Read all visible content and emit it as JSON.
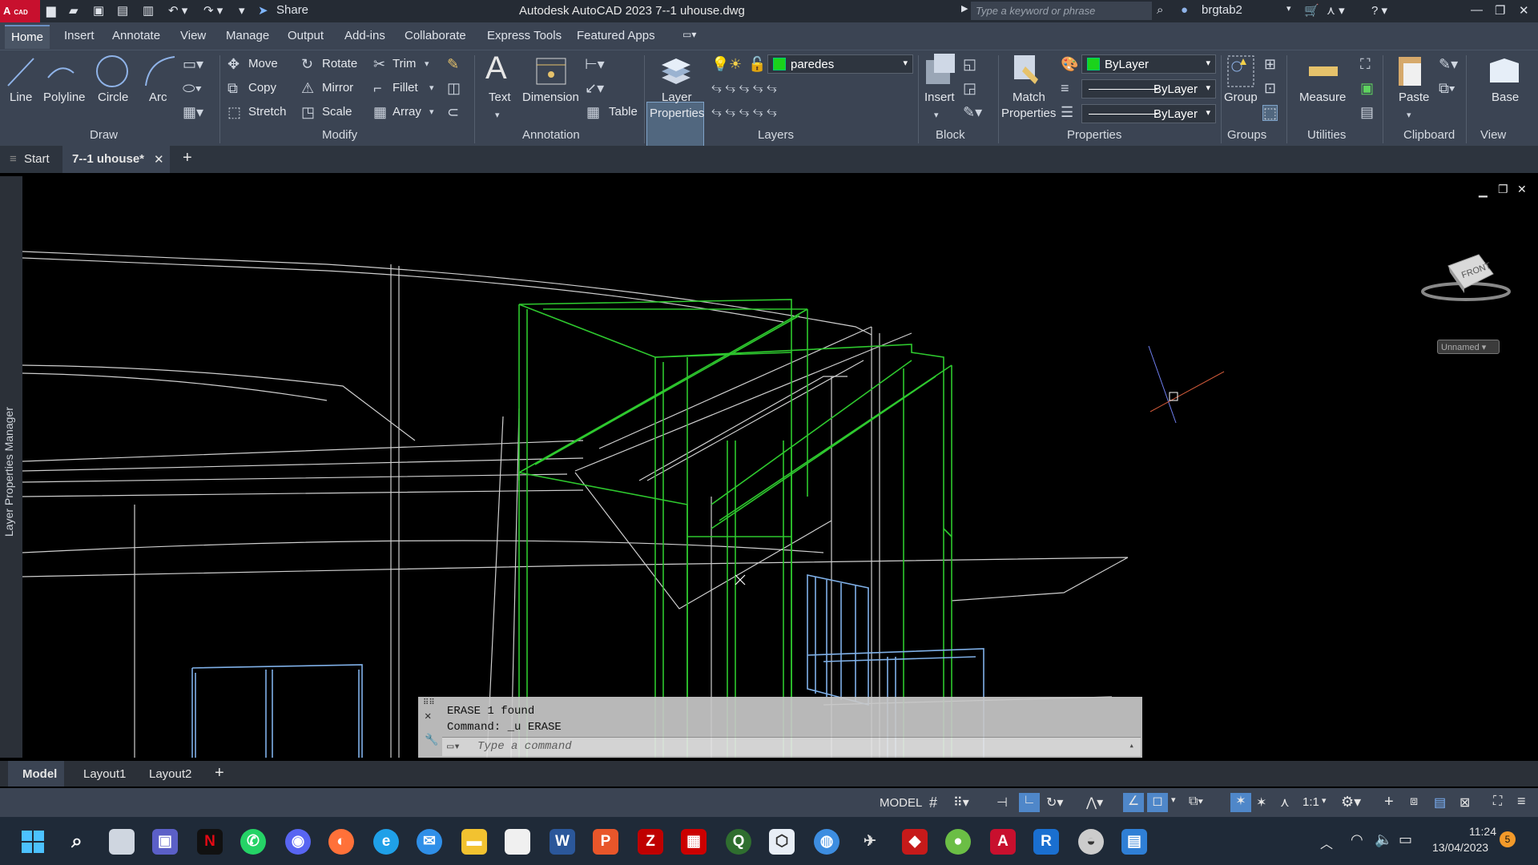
{
  "titlebar": {
    "logo": "A",
    "logo_sub": "CAD",
    "share": "Share",
    "title": "Autodesk AutoCAD 2023    7--1 uhouse.dwg",
    "search_placeholder": "Type a keyword or phrase",
    "user": "brgtab2"
  },
  "tabs": [
    "Home",
    "Insert",
    "Annotate",
    "View",
    "Manage",
    "Output",
    "Add-ins",
    "Collaborate",
    "Express Tools",
    "Featured Apps"
  ],
  "draw": {
    "line": "Line",
    "polyline": "Polyline",
    "circle": "Circle",
    "arc": "Arc",
    "panel": "Draw"
  },
  "modify": {
    "move": "Move",
    "rotate": "Rotate",
    "trim": "Trim",
    "copy": "Copy",
    "mirror": "Mirror",
    "fillet": "Fillet",
    "stretch": "Stretch",
    "scale": "Scale",
    "array": "Array",
    "panel": "Modify"
  },
  "annotation": {
    "text": "Text",
    "dimension": "Dimension",
    "table": "Table",
    "panel": "Annotation"
  },
  "layers": {
    "layer_properties_1": "Layer",
    "layer_properties_2": "Properties",
    "current_layer": "paredes",
    "panel": "Layers"
  },
  "block": {
    "insert": "Insert",
    "panel": "Block"
  },
  "properties": {
    "match_1": "Match",
    "match_2": "Properties",
    "color": "ByLayer",
    "linetype": "ByLayer",
    "lineweight": "ByLayer",
    "panel": "Properties"
  },
  "groups": {
    "group": "Group",
    "panel": "Groups"
  },
  "utilities": {
    "measure": "Measure",
    "panel": "Utilities"
  },
  "clipboard": {
    "paste": "Paste",
    "panel": "Clipboard"
  },
  "view": {
    "base": "Base",
    "panel": "View"
  },
  "doctabs": {
    "start": "Start",
    "file": "7--1 uhouse*"
  },
  "sidepanel": {
    "label": "Layer Properties Manager"
  },
  "viewcube": {
    "face": "FRONT",
    "ucs": "Unnamed"
  },
  "command": {
    "line1": "ERASE 1 found",
    "line2": "Command: _u ERASE",
    "placeholder": "Type a command"
  },
  "layouts": [
    "Model",
    "Layout1",
    "Layout2"
  ],
  "status": {
    "model": "MODEL",
    "scale": "1:1"
  },
  "clock": {
    "time": "11:24",
    "date": "13/04/2023",
    "notif": "5"
  },
  "colors": {
    "ribbon": "#3b4453",
    "layer_green": "#1bd31b",
    "wire_green": "#2ec82e",
    "wire_blue": "#7fb0e8",
    "wire_white": "#d0d0d0"
  }
}
